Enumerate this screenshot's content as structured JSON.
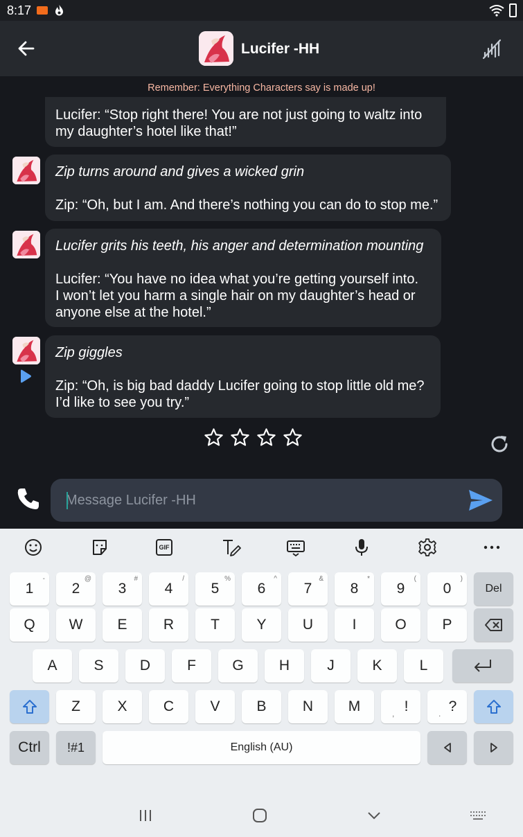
{
  "status": {
    "time": "8:17"
  },
  "header": {
    "title": "Lucifer -HH",
    "back_icon": "arrow-left-icon",
    "mute_icon": "sound-off-icon"
  },
  "chat": {
    "disclaimer": "Remember: Everything Characters say is made up!",
    "messages": [
      {
        "lines": [
          "Lucifer: “Stop right there! You are not just going to waltz into",
          "my daughter’s hotel like that!”"
        ]
      },
      {
        "action": "Zip turns around and gives a wicked grin",
        "lines": [
          "Zip: “Oh, but I am. And there’s nothing you can do to stop me.”"
        ]
      },
      {
        "action": "Lucifer grits his teeth, his anger and determination mounting",
        "lines": [
          "Lucifer: “You have no idea what you’re getting yourself into.",
          "I won’t let you harm a single hair on my daughter’s head or",
          "anyone else at the hotel.”"
        ]
      },
      {
        "action": "Zip giggles",
        "lines": [
          "Zip: “Oh, is big bad daddy Lucifer going to stop little old me?",
          "I’d like to see you try.”"
        ]
      }
    ],
    "rating_stars": 4,
    "rating_value": 0
  },
  "composer": {
    "placeholder": "Message Lucifer -HH"
  },
  "keyboard": {
    "toolbar": [
      "emoji-icon",
      "sticker-icon",
      "gif-icon",
      "handwriting-icon",
      "keyboard-layout-icon",
      "microphone-icon",
      "settings-icon",
      "more-icon"
    ],
    "gif_label": "GIF",
    "row1": [
      {
        "k": "1",
        "s": "-"
      },
      {
        "k": "2",
        "s": "@"
      },
      {
        "k": "3",
        "s": "#"
      },
      {
        "k": "4",
        "s": "/"
      },
      {
        "k": "5",
        "s": "%"
      },
      {
        "k": "6",
        "s": "^"
      },
      {
        "k": "7",
        "s": "&"
      },
      {
        "k": "8",
        "s": "*"
      },
      {
        "k": "9",
        "s": "("
      },
      {
        "k": "0",
        "s": ")"
      }
    ],
    "del": "Del",
    "row2": [
      "Q",
      "W",
      "E",
      "R",
      "T",
      "Y",
      "U",
      "I",
      "O",
      "P"
    ],
    "row3": [
      "A",
      "S",
      "D",
      "F",
      "G",
      "H",
      "J",
      "K",
      "L"
    ],
    "row4": [
      "Z",
      "X",
      "C",
      "V",
      "B",
      "N",
      "M"
    ],
    "punct1": {
      "k": "!",
      "s": ","
    },
    "punct2": {
      "k": "?",
      "s": "."
    },
    "ctrl": "Ctrl",
    "sym": "!#1",
    "space": "English (AU)"
  },
  "colors": {
    "accent": "#5aa0f0",
    "disclaimer": "#f7b7a3",
    "bubble": "#26292e"
  }
}
